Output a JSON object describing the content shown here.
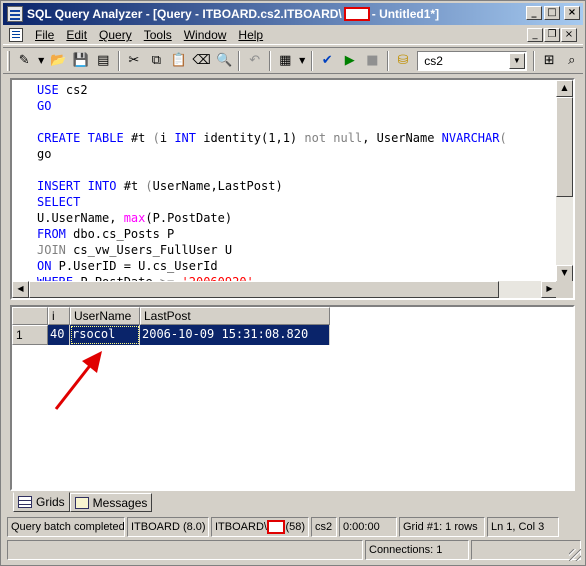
{
  "window": {
    "title_prefix": "SQL Query Analyzer - [Query - ITBOARD.cs2.ITBOARD\\",
    "title_suffix": " - Untitled1*]",
    "controls": [
      "minimize",
      "maximize",
      "close"
    ]
  },
  "menu": {
    "items": [
      "File",
      "Edit",
      "Query",
      "Tools",
      "Window",
      "Help"
    ],
    "mdi_controls": [
      "_",
      "❐",
      "×"
    ]
  },
  "toolbar": {
    "database": "cs2",
    "icons": [
      "new-query-icon",
      "open-icon",
      "save-icon",
      "load-script-icon",
      "cut-icon",
      "copy-icon",
      "paste-icon",
      "clear-window-icon",
      "find-icon",
      "undo-icon",
      "results-mode-icon",
      "parse-icon",
      "execute-icon",
      "cancel-icon",
      "database-icon",
      "object-browser-icon",
      "object-search-icon"
    ]
  },
  "editor": {
    "lines": [
      [
        {
          "t": "USE",
          "c": "kw"
        },
        {
          "t": " cs2",
          "c": ""
        }
      ],
      [
        {
          "t": "GO",
          "c": "kw"
        }
      ],
      [],
      [
        {
          "t": "CREATE",
          "c": "kw"
        },
        {
          "t": " ",
          "c": ""
        },
        {
          "t": "TABLE",
          "c": "kw"
        },
        {
          "t": " #t ",
          "c": ""
        },
        {
          "t": "(",
          "c": "gy"
        },
        {
          "t": "i ",
          "c": ""
        },
        {
          "t": "INT",
          "c": "kw"
        },
        {
          "t": " ",
          "c": ""
        },
        {
          "t": "identity",
          "c": ""
        },
        {
          "t": "(1,1) ",
          "c": ""
        },
        {
          "t": "not null",
          "c": "gy"
        },
        {
          "t": ", UserName ",
          "c": ""
        },
        {
          "t": "NVARCHAR",
          "c": "kw"
        },
        {
          "t": "(",
          "c": "gy"
        }
      ],
      [
        {
          "t": "go",
          "c": ""
        }
      ],
      [],
      [
        {
          "t": "INSERT",
          "c": "kw"
        },
        {
          "t": " ",
          "c": ""
        },
        {
          "t": "INTO",
          "c": "kw"
        },
        {
          "t": " #t ",
          "c": ""
        },
        {
          "t": "(",
          "c": "gy"
        },
        {
          "t": "UserName,LastPost)",
          "c": ""
        }
      ],
      [
        {
          "t": "SELECT",
          "c": "kw"
        }
      ],
      [
        {
          "t": "U.UserName, ",
          "c": ""
        },
        {
          "t": "max",
          "c": "fn"
        },
        {
          "t": "(P.PostDate)",
          "c": ""
        }
      ],
      [
        {
          "t": "FROM",
          "c": "kw"
        },
        {
          "t": " dbo.cs_Posts P",
          "c": ""
        }
      ],
      [
        {
          "t": "JOIN",
          "c": "gy"
        },
        {
          "t": " cs_vw_Users_FullUser U",
          "c": ""
        }
      ],
      [
        {
          "t": "ON",
          "c": "kw"
        },
        {
          "t": " P.UserID = U.cs_UserId",
          "c": ""
        }
      ],
      [
        {
          "t": "WHERE",
          "c": "kw"
        },
        {
          "t": " P.PostDate ",
          "c": ""
        },
        {
          "t": ">=",
          "c": "gy"
        },
        {
          "t": " ",
          "c": ""
        },
        {
          "t": "'20060920'",
          "c": "str"
        }
      ]
    ]
  },
  "results": {
    "columns": [
      "i",
      "UserName",
      "LastPost"
    ],
    "rows": [
      {
        "num": "1",
        "cells": [
          "40",
          "rsocol",
          "2006-10-09 15:31:08.820"
        ]
      }
    ]
  },
  "result_tabs": [
    "Grids",
    "Messages"
  ],
  "status": {
    "message": "Query batch completed",
    "server": "ITBOARD (8.0)",
    "user_prefix": "ITBOARD\\",
    "spid": "(58)",
    "database": "cs2",
    "elapsed": "0:00:00",
    "grid_info": "Grid #1: 1 rows",
    "position": "Ln 1, Col 3",
    "connections": "Connections: 1"
  },
  "colors": {
    "selection": "#0a246a",
    "keyword": "#0000ff",
    "function": "#ff00ff",
    "string": "#ff0000",
    "annotation_arrow": "#e00000"
  }
}
